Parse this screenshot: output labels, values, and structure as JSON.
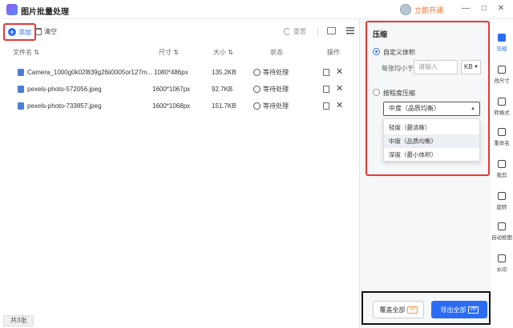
{
  "app": {
    "title": "图片批量处理",
    "open_vip": "立即开通",
    "minimize": "—",
    "maximize": "□",
    "close": "✕"
  },
  "toolbar": {
    "add_label": "添加",
    "add_icon": "+",
    "clear_label": "清空",
    "reset_label": "重置"
  },
  "table": {
    "headers": {
      "name": "文件名 ⇅",
      "dimensions": "尺寸 ⇅",
      "size": "大小 ⇅",
      "status": "状态",
      "action": "操作"
    },
    "rows": [
      {
        "name": "Camera_1000g0k02l839g26ii0005or127m...",
        "dimensions": "1080*486px",
        "size": "135.2KB",
        "status": "等待处理"
      },
      {
        "name": "pexels-photo-572056.jpeg",
        "dimensions": "1600*1067px",
        "size": "92.7KB",
        "status": "等待处理"
      },
      {
        "name": "pexels-photo-733857.jpeg",
        "dimensions": "1600*1068px",
        "size": "151.7KB",
        "status": "等待处理"
      }
    ],
    "row_close": "✕"
  },
  "footer": {
    "count": "共3张"
  },
  "compress": {
    "title": "压缩",
    "option_custom": "自定义体积",
    "size_label": "每张均小于",
    "size_placeholder": "请输入",
    "unit": "KB",
    "option_level": "按程度压缩",
    "level_selected": "中度（品质均衡）",
    "level_options": [
      "轻度（最清晰）",
      "中度（品质均衡）",
      "深度（最小体积）"
    ],
    "caret_up": "▲",
    "caret_down": "▼"
  },
  "actions": {
    "overwrite": "覆盖全部",
    "export": "导出全部",
    "vip": "VIP"
  },
  "rail": [
    {
      "label": "压缩"
    },
    {
      "label": "改尺寸"
    },
    {
      "label": "转格式"
    },
    {
      "label": "重命名"
    },
    {
      "label": "裁剪"
    },
    {
      "label": "旋转"
    },
    {
      "label": "自动抠图"
    },
    {
      "label": "水印"
    }
  ],
  "colors": {
    "accent": "#2b6cf6",
    "highlight_box": "#e53935",
    "vip": "#e8722a"
  }
}
